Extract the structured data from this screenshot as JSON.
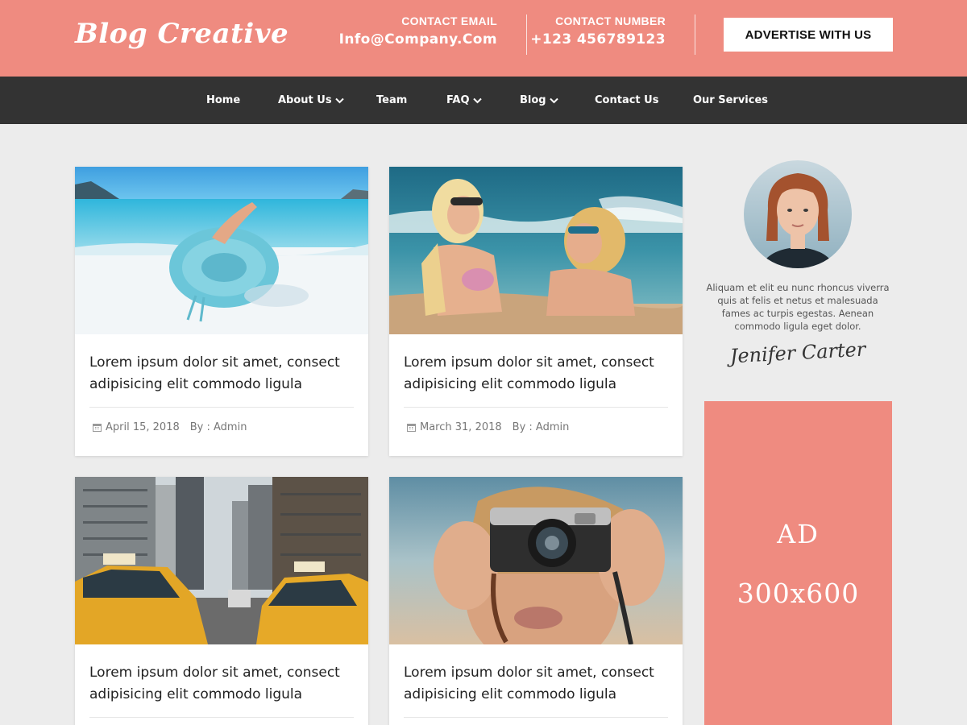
{
  "header": {
    "logo": "Blog Creative",
    "contact_email": {
      "label": "CONTACT EMAIL",
      "value": "Info@Company.Com"
    },
    "contact_number": {
      "label": "CONTACT NUMBER",
      "value": "+123 456789123"
    },
    "advertise_label": "ADVERTISE WITH US",
    "colors": {
      "accent": "#ef8b80",
      "nav": "#333333",
      "page": "#ececec"
    }
  },
  "nav": {
    "items": [
      {
        "label": "Home",
        "dropdown": false
      },
      {
        "label": "About Us",
        "dropdown": true
      },
      {
        "label": "Team",
        "dropdown": false
      },
      {
        "label": "FAQ",
        "dropdown": true
      },
      {
        "label": "Blog",
        "dropdown": true
      },
      {
        "label": "Contact Us",
        "dropdown": false
      },
      {
        "label": "Our Services",
        "dropdown": false
      }
    ]
  },
  "posts": [
    {
      "title": "Lorem ipsum dolor sit amet, consect adipisicing elit commodo ligula",
      "date": "April 15, 2018",
      "by": "By : Admin",
      "image": "beach-hat-photo"
    },
    {
      "title": "Lorem ipsum dolor sit amet, consect adipisicing elit commodo ligula",
      "date": "March 31, 2018",
      "by": "By : Admin",
      "image": "beach-friends-photo"
    },
    {
      "title": "Lorem ipsum dolor sit amet, consect adipisicing elit commodo ligula",
      "image": "city-taxis-photo"
    },
    {
      "title": "Lorem ipsum dolor sit amet, consect adipisicing elit commodo ligula",
      "image": "camera-photo"
    }
  ],
  "sidebar": {
    "bio": "Aliquam et elit eu nunc rhoncus viverra quis at felis et netus et malesuada fames ac turpis egestas. Aenean commodo ligula eget dolor.",
    "signature": "Jenifer Carter",
    "ad_line1": "AD",
    "ad_line2": "300x600"
  }
}
